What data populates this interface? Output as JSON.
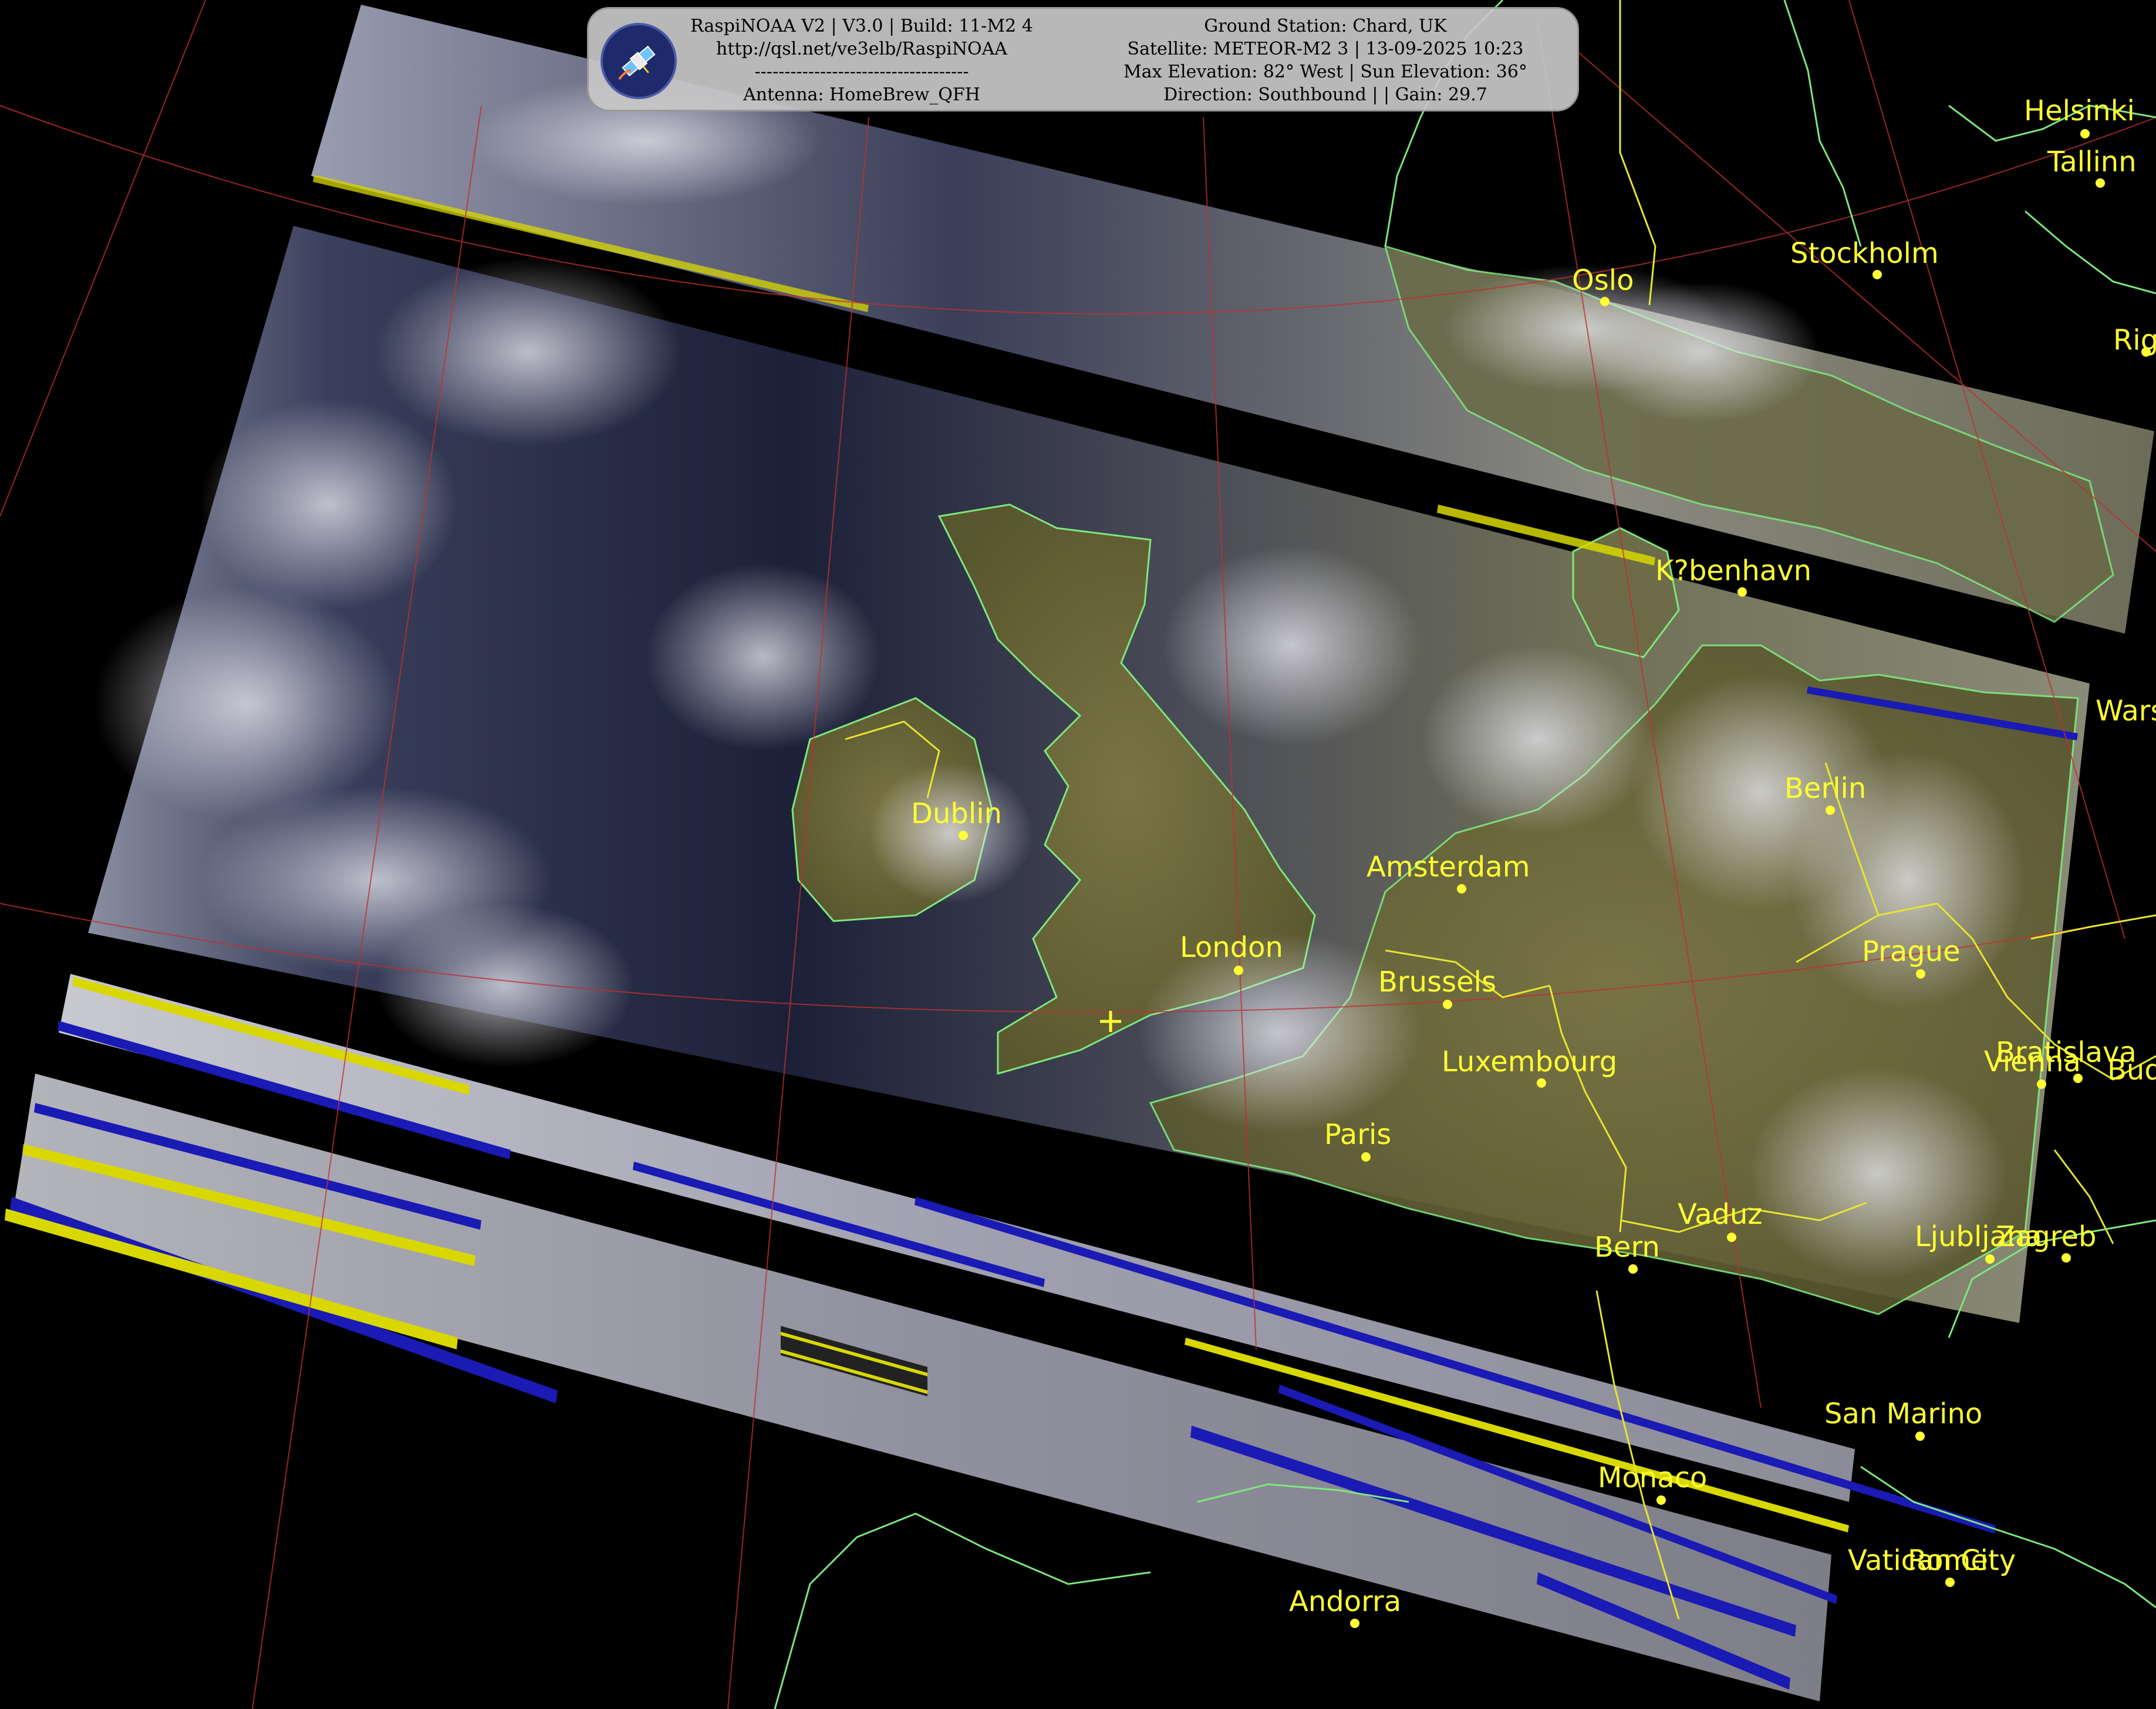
{
  "info": {
    "app": "RaspiNOAA V2 | V3.0 | Build: 11-M2 4",
    "url": "http://qsl.net/ve3elb/RaspiNOAA",
    "divider": "------------------------------------",
    "antenna": "Antenna: HomeBrew_QFH",
    "station": "Ground Station: Chard, UK",
    "satellite": "Satellite: METEOR-M2 3 | 13-09-2025 10:23",
    "elevation": "Max Elevation: 82° West | Sun Elevation: 36°",
    "direction": "Direction: Southbound | | Gain: 29.7"
  },
  "logo_icon": "satellite-icon",
  "colors": {
    "city_label": "#ffff33",
    "coastline": "#7de87d",
    "border": "#e6e62e",
    "graticule": "#c03030",
    "noise_blue": "#1a1ab4",
    "noise_yellow": "#d8d800"
  },
  "cities": [
    {
      "name": "Helsinki"
    },
    {
      "name": "Tallinn"
    },
    {
      "name": "Stockholm"
    },
    {
      "name": "Oslo"
    },
    {
      "name": "Riga"
    },
    {
      "name": "K?benhavn"
    },
    {
      "name": "Warsaw"
    },
    {
      "name": "Berlin"
    },
    {
      "name": "Dublin"
    },
    {
      "name": "Amsterdam"
    },
    {
      "name": "London"
    },
    {
      "name": "Brussels"
    },
    {
      "name": "Prague"
    },
    {
      "name": "Luxembourg"
    },
    {
      "name": "Vienna"
    },
    {
      "name": "Bratislava"
    },
    {
      "name": "Budapest"
    },
    {
      "name": "Paris"
    },
    {
      "name": "Vaduz"
    },
    {
      "name": "Bern"
    },
    {
      "name": "Ljubljana"
    },
    {
      "name": "Zagreb"
    },
    {
      "name": "San Marino"
    },
    {
      "name": "Monaco"
    },
    {
      "name": "Vatican City"
    },
    {
      "name": "Rome"
    },
    {
      "name": "Andorra"
    }
  ]
}
